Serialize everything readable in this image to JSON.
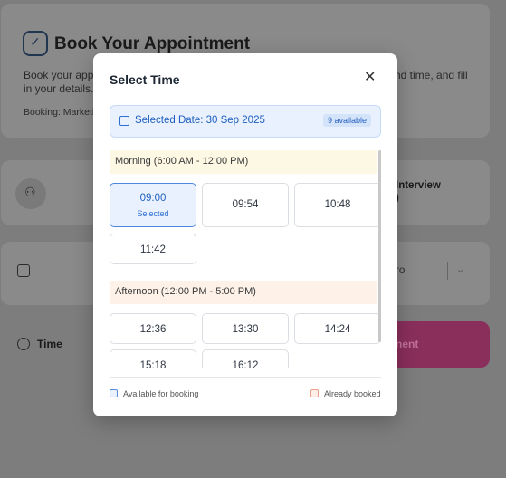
{
  "background": {
    "title": "Book Your Appointment",
    "description_left": "Book your appo",
    "description_right": "nd time, and fill",
    "description_line2": "in your details.",
    "booking": "Booking: Marketi",
    "row1_right_line1": "Interview",
    "row1_right_line2": ")",
    "row2_right": "ro",
    "time_label": "Time",
    "submit_partial": "nent"
  },
  "modal": {
    "title": "Select Time",
    "close_symbol": "✕",
    "selected_date": "Selected Date: 30 Sep 2025",
    "available_badge": "9 available",
    "morning_label": "Morning (6:00 AM - 12:00 PM)",
    "afternoon_label": "Afternoon (12:00 PM - 5:00 PM)",
    "morning_slots": [
      "09:00",
      "09:54",
      "10:48",
      "11:42"
    ],
    "selected_sub": "Selected",
    "afternoon_slots": [
      "12:36",
      "13:30",
      "14:24",
      "15:18",
      "16:12"
    ],
    "legend_available": "Available for booking",
    "legend_booked": "Already booked"
  },
  "colors": {
    "accent": "#2f6fd0",
    "morning_bg": "#fdf8e4",
    "afternoon_bg": "#fdf1e8",
    "submit": "#c2185b"
  },
  "icons": [
    "calendar-check-icon",
    "user-icon",
    "calendar-icon",
    "clock-icon",
    "close-icon",
    "chevron-down-icon"
  ]
}
